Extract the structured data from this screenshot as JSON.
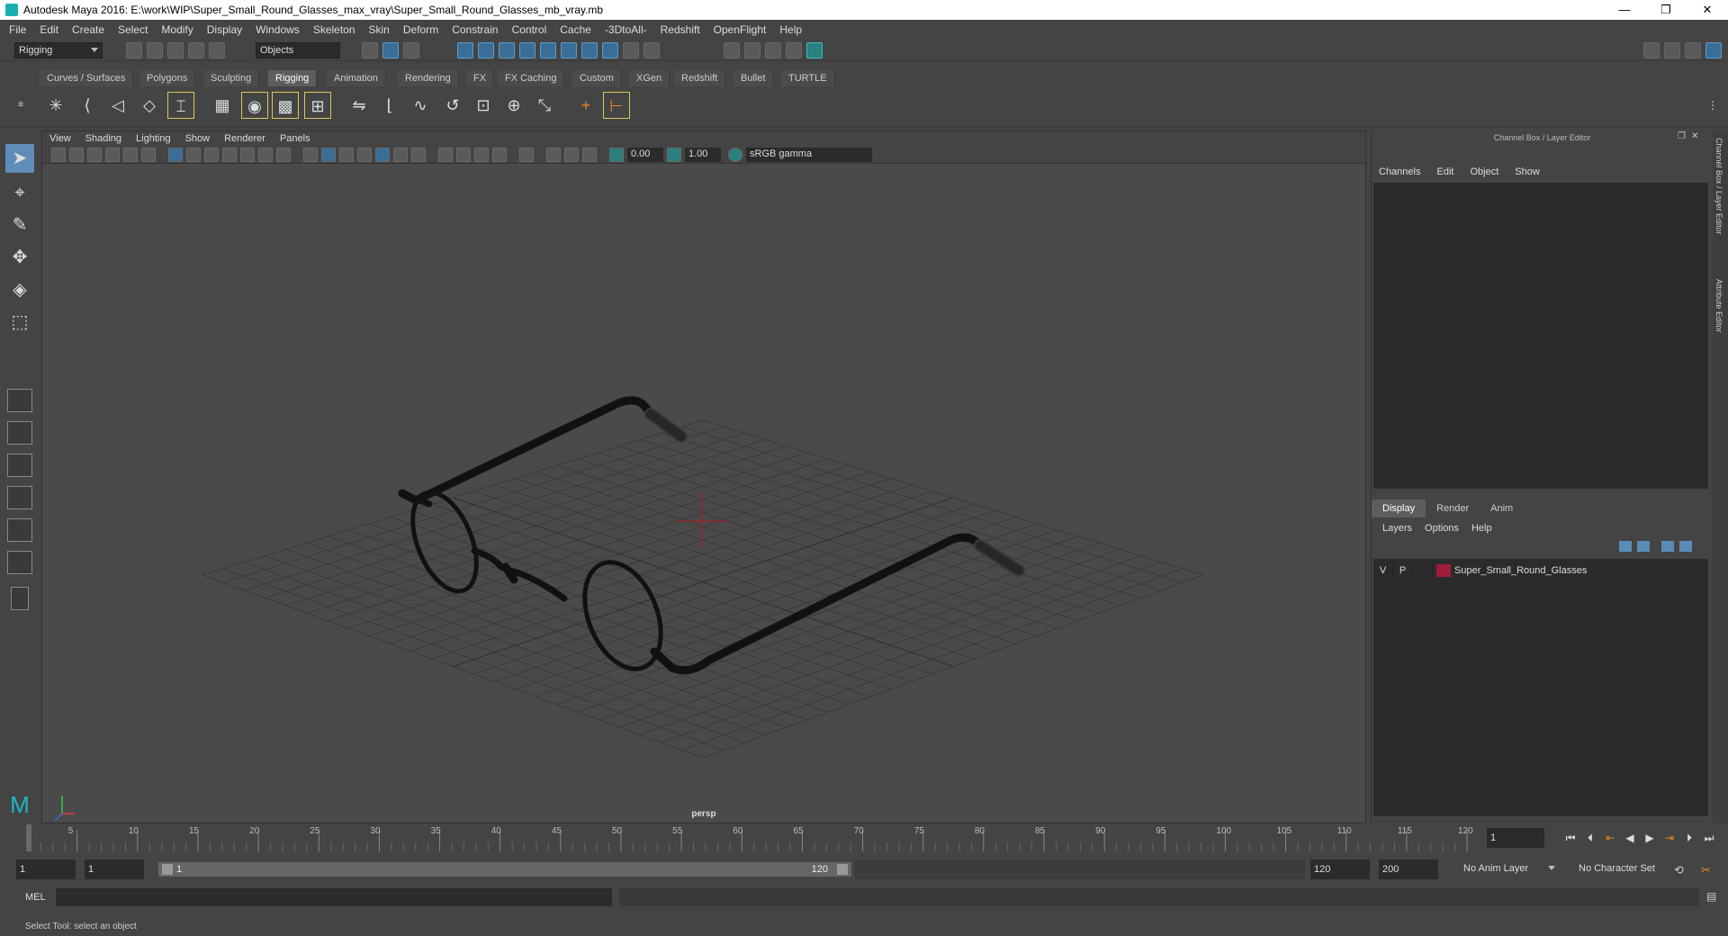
{
  "title": "Autodesk Maya 2016: E:\\work\\WIP\\Super_Small_Round_Glasses_max_vray\\Super_Small_Round_Glasses_mb_vray.mb",
  "window_buttons": [
    "—",
    "❐",
    "✕"
  ],
  "menubar": [
    "File",
    "Edit",
    "Create",
    "Select",
    "Modify",
    "Display",
    "Windows",
    "Skeleton",
    "Skin",
    "Deform",
    "Constrain",
    "Control",
    "Cache",
    "-3DtoAll-",
    "Redshift",
    "OpenFlight",
    "Help"
  ],
  "status": {
    "mode": "Rigging",
    "selection_mode": "Objects"
  },
  "shelf_tabs": [
    "Curves / Surfaces",
    "Polygons",
    "Sculpting",
    "Rigging",
    "Animation",
    "Rendering",
    "FX",
    "FX Caching",
    "Custom",
    "XGen",
    "Redshift",
    "Bullet",
    "TURTLE"
  ],
  "active_shelf_tab": "Rigging",
  "viewport": {
    "menu": [
      "View",
      "Shading",
      "Lighting",
      "Show",
      "Renderer",
      "Panels"
    ],
    "exposure": "0.00",
    "gamma": "1.00",
    "color_space": "sRGB gamma",
    "camera_label": "persp"
  },
  "right_panel": {
    "title": "Channel Box / Layer Editor",
    "menu": [
      "Channels",
      "Edit",
      "Object",
      "Show"
    ],
    "layer_tabs": [
      "Display",
      "Render",
      "Anim"
    ],
    "active_layer_tab": "Display",
    "layer_menu": [
      "Layers",
      "Options",
      "Help"
    ],
    "layers": [
      {
        "v": "V",
        "p": "P",
        "name": "Super_Small_Round_Glasses",
        "color": "#a01c3c"
      }
    ],
    "side_tabs": [
      "Channel Box / Layer Editor",
      "Attribute Editor"
    ]
  },
  "timeline": {
    "ticks": [
      "1",
      "5",
      "10",
      "15",
      "20",
      "25",
      "30",
      "35",
      "40",
      "45",
      "50",
      "55",
      "60",
      "65",
      "70",
      "75",
      "80",
      "85",
      "90",
      "95",
      "100",
      "105",
      "110",
      "115",
      "120"
    ],
    "current_frame": "1"
  },
  "range": {
    "start": "1",
    "playback_start": "1",
    "slider_start": "1",
    "slider_end": "120",
    "playback_end": "120",
    "end": "200",
    "anim_layer": "No Anim Layer",
    "char_set": "No Character Set"
  },
  "cmd": {
    "lang": "MEL"
  },
  "help_line": "Select Tool: select an object"
}
